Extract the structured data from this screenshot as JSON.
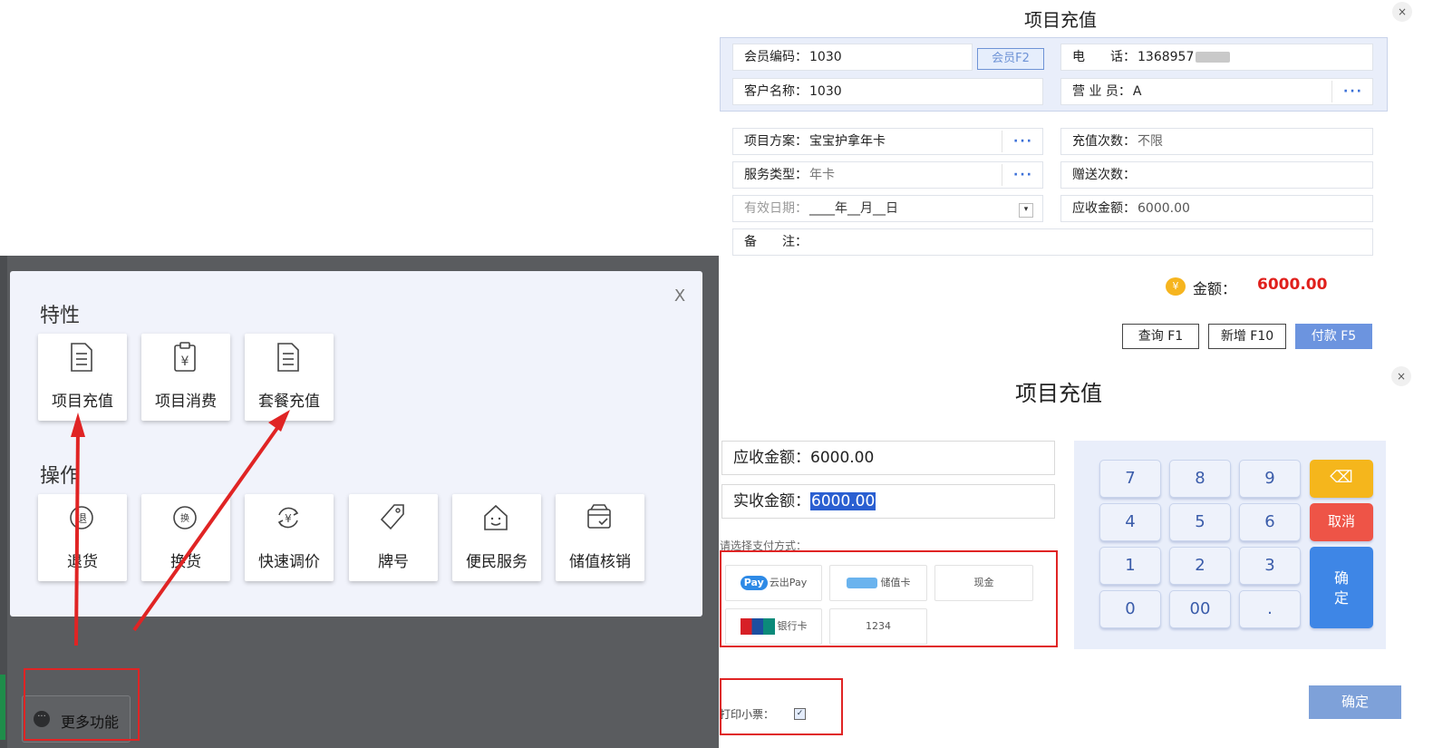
{
  "modal": {
    "close": "X",
    "section_features": "特性",
    "section_operations": "操作",
    "features": [
      {
        "label": "项目充值",
        "icon": "document-list-icon"
      },
      {
        "label": "项目消费",
        "icon": "yen-clipboard-icon"
      },
      {
        "label": "套餐充值",
        "icon": "document-list-icon"
      }
    ],
    "operations": [
      {
        "label": "退货",
        "icon": "return-icon",
        "glyph": "退"
      },
      {
        "label": "换货",
        "icon": "exchange-icon",
        "glyph": "换"
      },
      {
        "label": "快速调价",
        "icon": "price-adjust-icon"
      },
      {
        "label": "牌号",
        "icon": "tag-icon"
      },
      {
        "label": "便民服务",
        "icon": "service-house-icon"
      },
      {
        "label": "储值核销",
        "icon": "stored-value-icon"
      }
    ]
  },
  "more_button": {
    "label": "更多功能",
    "icon": "more-dots-icon",
    "glyph": "···"
  },
  "recharge_form": {
    "title": "项目充值",
    "close": "×",
    "member_no_label": "会员编码：",
    "member_no_value": "1030",
    "member_btn": "会员F2",
    "phone_label": "电　　话：",
    "phone_value": "1368957",
    "customer_label": "客户名称：",
    "customer_value": "1030",
    "salesman_label": "营 业 员：",
    "salesman_value": "A",
    "plan_label": "项目方案：",
    "plan_value": "宝宝护拿年卡",
    "times_label": "充值次数：",
    "times_value": "不限",
    "service_label": "服务类型：",
    "service_value": "年卡",
    "gift_label": "赠送次数：",
    "gift_value": "",
    "date_label": "有效日期：",
    "date_value": "____年__月__日",
    "due_label": "应收金额：",
    "due_value": "6000.00",
    "remark_label": "备　　注：",
    "amount_label": "金额：",
    "amount_value": "6000.00",
    "coin_glyph": "¥",
    "dots": "···",
    "buttons": {
      "query": "查询 F1",
      "add": "新增 F10",
      "pay": "付款 F5"
    }
  },
  "payment": {
    "title": "项目充值",
    "close": "×",
    "due_label": "应收金额：",
    "due_value": "6000.00",
    "paid_label": "实收金额：",
    "paid_value": "6000.00",
    "prompt": "请选择支付方式：",
    "methods": [
      {
        "label": "云出Pay",
        "logo": "Pay"
      },
      {
        "label": "储值卡"
      },
      {
        "label": "现金"
      },
      {
        "label": "银行卡"
      },
      {
        "label": "1234"
      }
    ],
    "keypad": {
      "keys": [
        "7",
        "8",
        "9",
        "4",
        "5",
        "6",
        "1",
        "2",
        "3",
        "0",
        "00",
        "."
      ],
      "backspace": "⌫",
      "cancel": "取消",
      "confirm": "确定"
    },
    "print_label": "打印小票：",
    "print_checked": "✓",
    "confirm_btn": "确定"
  },
  "colors": {
    "accent_blue": "#3e86e6",
    "danger_red": "#e02424",
    "amount_red": "#e0201c",
    "key_yellow": "#f5b61c"
  }
}
